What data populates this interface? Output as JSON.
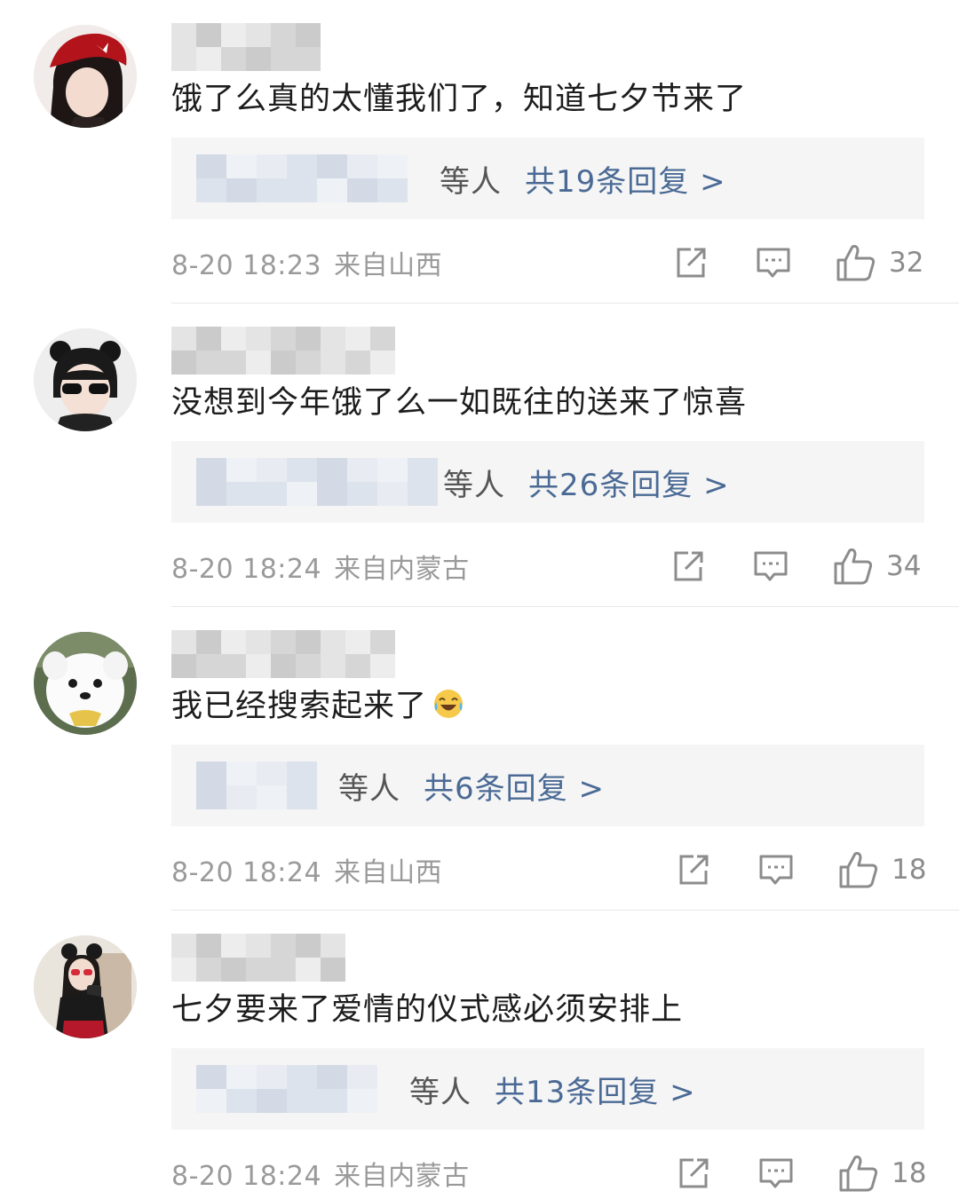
{
  "comments": [
    {
      "text": "饿了么真的太懂我们了，知道七夕节来了",
      "reply_people": "等人",
      "reply_link": "共19条回复 >",
      "date": "8-20 18:23",
      "location": "来自山西",
      "likes": "32",
      "avatar": "girl-red-hat-avatar"
    },
    {
      "text": "没想到今年饿了么一如既往的送来了惊喜",
      "reply_people": "等人",
      "reply_link": "共26条回复 >",
      "date": "8-20 18:24",
      "location": "来自内蒙古",
      "likes": "34",
      "avatar": "child-sunglasses-avatar"
    },
    {
      "text": "我已经搜索起来了",
      "emoji": "laughing-tears-emoji",
      "reply_people": "等人",
      "reply_link": "共6条回复 >",
      "date": "8-20 18:24",
      "location": "来自山西",
      "likes": "18",
      "avatar": "white-dog-avatar"
    },
    {
      "text": "七夕要来了爱情的仪式感必须安排上",
      "reply_people": "等人",
      "reply_link": "共13条回复 >",
      "date": "8-20 18:24",
      "location": "来自内蒙古",
      "likes": "18",
      "avatar": "girl-mirror-selfie-avatar"
    }
  ],
  "icons": {
    "share": "share-icon",
    "comment": "comment-icon",
    "like": "like-icon"
  },
  "colors": {
    "reply_link": "#4a6a95",
    "meta": "#9a9a9a",
    "reply_bg": "#f5f5f5"
  }
}
